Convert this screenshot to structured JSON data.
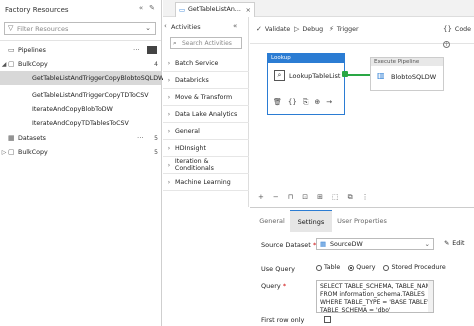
{
  "left_panel": {
    "title": "Factory Resources",
    "filter_placeholder": "Filter Resources",
    "pipelines": {
      "label": "Pipelines",
      "count": "4"
    },
    "bulkcopy_folder": {
      "label": "BulkCopy",
      "count": "4"
    },
    "pipeline_items": [
      "GetTableListAndTriggerCopyBlobtoSQLDW",
      "GetTableListAndTriggerCopyTDToCSV",
      "IterateAndCopyBlobToDW",
      "IterateAndCopyTDTablesToCSV"
    ],
    "datasets": {
      "label": "Datasets",
      "count": "5"
    },
    "datasets_folder": {
      "label": "BulkCopy",
      "count": "5"
    }
  },
  "tab": {
    "label": "GetTableListAn..."
  },
  "activities": {
    "title": "Activities",
    "search_placeholder": "Search Activities",
    "categories": [
      "Batch Service",
      "Databricks",
      "Move & Transform",
      "Data Lake Analytics",
      "General",
      "HDInsight",
      "Iteration & Conditionals",
      "Machine Learning"
    ]
  },
  "toolbar": {
    "validate": "Validate",
    "debug": "Debug",
    "trigger": "Trigger",
    "code": "Code"
  },
  "canvas": {
    "lookup": {
      "type": "Lookup",
      "name": "LookupTableList"
    },
    "execute": {
      "type": "Execute Pipeline",
      "name": "BlobtoSQLDW"
    }
  },
  "properties": {
    "tabs": [
      "General",
      "Settings",
      "User Properties"
    ],
    "active_tab": "Settings",
    "source_dataset_label": "Source Dataset",
    "source_dataset_value": "SourceDW",
    "edit_label": "Edit",
    "use_query_label": "Use Query",
    "use_query_options": [
      "Table",
      "Query",
      "Stored Procedure"
    ],
    "use_query_selected": "Query",
    "query_label": "Query",
    "query_text": "SELECT TABLE_SCHEMA, TABLE_NAME\nFROM information_schema.TABLES\nWHERE TABLE_TYPE = 'BASE TABLE' and\nTABLE_SCHEMA = 'dbo'",
    "first_row_only_label": "First row only"
  },
  "colors": {
    "accent": "#2b7cd3",
    "success": "#2aa745"
  }
}
